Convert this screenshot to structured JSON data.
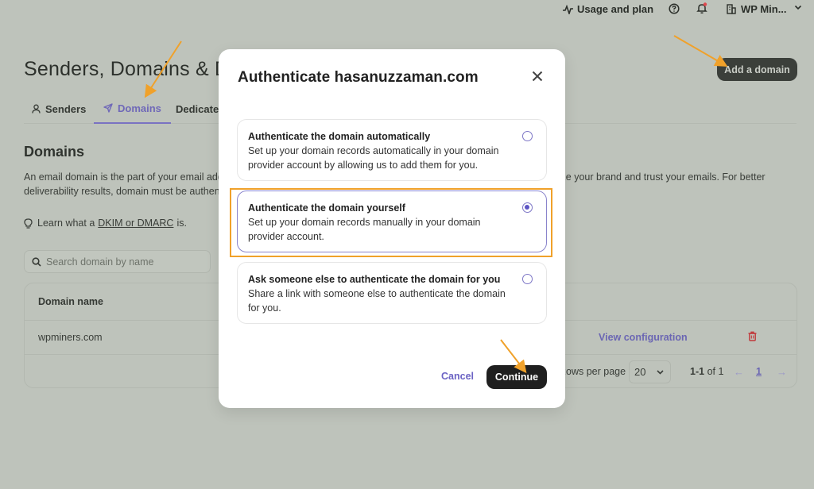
{
  "topbar": {
    "usage_label": "Usage and plan",
    "org_label": "WP Min..."
  },
  "header": {
    "title": "Senders, Domains & Dedicated IPs",
    "add_domain_label": "Add a domain"
  },
  "tabs": [
    {
      "label": "Senders",
      "icon": "user-icon",
      "active": false
    },
    {
      "label": "Domains",
      "icon": "send-icon",
      "active": true
    },
    {
      "label": "Dedicated IPs",
      "icon": "",
      "active": false
    }
  ],
  "domains_section": {
    "title": "Domains",
    "description": "An email domain is the part of your email address after the @ symbol. Authenticating your domain helps recipients recognize your brand and trust your emails. For better deliverability results, domain must be authenticated.",
    "learn_prefix": "Learn what a",
    "learn_link": "DKIM or DMARC",
    "learn_suffix": "is.",
    "search_placeholder": "Search domain by name"
  },
  "table": {
    "headers": [
      "Domain name"
    ],
    "rows": [
      {
        "domain": "wpminers.com",
        "action_label": "View configuration"
      }
    ],
    "pagination": {
      "rows_per_page_label": "Rows per page",
      "rows_per_page": "20",
      "range_bold": "1-1",
      "range_suffix": "of 1",
      "current_page": "1"
    }
  },
  "modal": {
    "title": "Authenticate hasanuzzaman.com",
    "options": [
      {
        "title": "Authenticate the domain automatically",
        "description": "Set up your domain records automatically in your domain provider account by allowing us to add them for you.",
        "selected": false
      },
      {
        "title": "Authenticate the domain yourself",
        "description": "Set up your domain records manually in your domain provider account.",
        "selected": true
      },
      {
        "title": "Ask someone else to authenticate the domain for you",
        "description": "Share a link with someone else to authenticate the domain for you.",
        "selected": false
      }
    ],
    "cancel_label": "Cancel",
    "continue_label": "Continue"
  },
  "colors": {
    "accent": "#6b63c4",
    "annotation": "#f0a12a",
    "overlay_bg": "#bec3bb",
    "danger": "#c0393b"
  }
}
